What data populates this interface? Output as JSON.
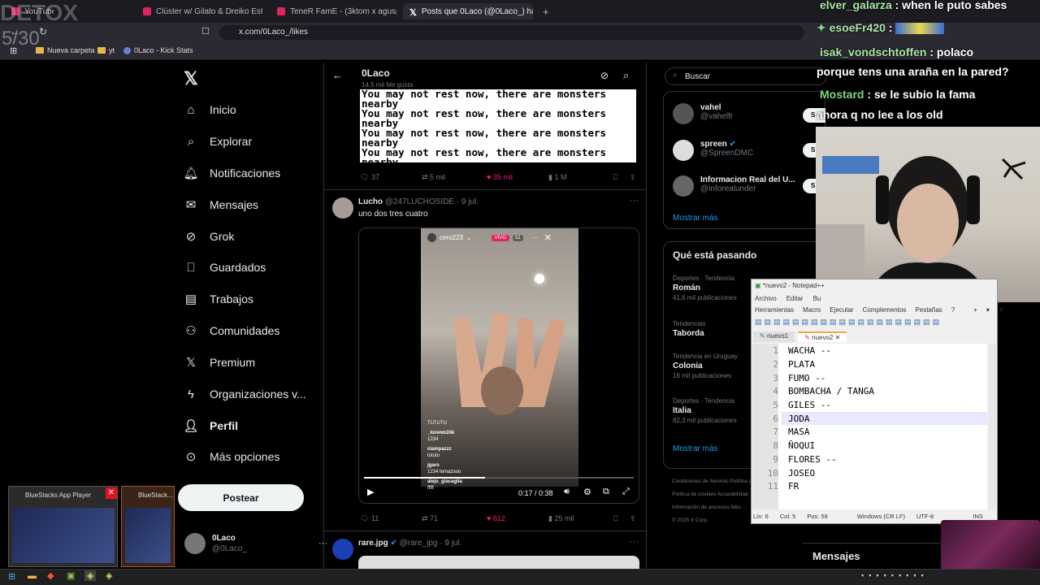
{
  "browser": {
    "tabs": [
      {
        "label": "YouTube"
      },
      {
        "label": "Clúster w/ Gilato & Dreiko Estrada -"
      },
      {
        "label": "TeneR FamE - (3ktom x aguspvz x kid"
      },
      {
        "label": "Posts que 0Laco (@0Laco_) ha m"
      }
    ],
    "url": "x.com/0Laco_/likes",
    "bookmarks": [
      "Nueva carpeta",
      "yt",
      "0Laco - Kick Stats"
    ]
  },
  "overlay": {
    "top": "DETOX",
    "counter": "5/30"
  },
  "nav": {
    "items": [
      "Inicio",
      "Explorar",
      "Notificaciones",
      "Mensajes",
      "Grok",
      "Guardados",
      "Trabajos",
      "Comunidades",
      "Premium",
      "Organizaciones v...",
      "Perfil",
      "Más opciones"
    ],
    "post_label": "Postear",
    "profile_name": "0Laco",
    "profile_handle": "@0Laco_"
  },
  "header": {
    "title": "0Laco",
    "subtitle": "14,5 mil Me gusta"
  },
  "tweet1": {
    "image_line": "You may not rest now, there are monsters nearby",
    "replies": "37",
    "reposts": "5 mil",
    "likes": "35 mil",
    "views": "1 M"
  },
  "tweet2": {
    "name": "Lucho",
    "handle": "@247LUCHOSIDE",
    "date": "· 9 jul.",
    "text": "uno dos tres cuatro",
    "live_user": "cero223",
    "live_badge": "VIVO",
    "live_viewers": "52",
    "comments": [
      {
        "user": "TUTUTU",
        "msg": ""
      },
      {
        "user": "_lorenm24k",
        "msg": "1234"
      },
      {
        "user": "ciampazzz",
        "msg": "tututu"
      },
      {
        "user": "jgaro",
        "msg": "1234 temazooo"
      },
      {
        "user": "alejo_giacaglia",
        "msg": "fffff"
      }
    ],
    "time": "0:17 / 0:38",
    "replies": "11",
    "reposts": "71",
    "likes": "612",
    "views": "25 mil"
  },
  "tweet3": {
    "name": "rare.jpg",
    "handle": "@rare_jpg",
    "date": "· 9 jul."
  },
  "search": {
    "placeholder": "Buscar"
  },
  "who": [
    {
      "name": "vahel",
      "handle": "@vahelfr",
      "btn": "S"
    },
    {
      "name": "spreen",
      "handle": "@SpreenDMC",
      "btn": "S"
    },
    {
      "name": "Informacion Real del U...",
      "handle": "@inforealunder",
      "btn": "S"
    }
  ],
  "show_more": "Mostrar más",
  "trends_title": "Qué está pasando",
  "trends": [
    {
      "cat": "Deportes · Tendencia",
      "name": "Román",
      "count": "41,6 mil publicaciones"
    },
    {
      "cat": "Tendencias",
      "name": "Taborda",
      "count": ""
    },
    {
      "cat": "Tendencia en Uruguay",
      "name": "Colonia",
      "count": "16 mil publicaciones"
    },
    {
      "cat": "Deportes · Tendencia",
      "name": "Italia",
      "count": "82,3 mil publicaciones"
    }
  ],
  "footer": {
    "links": "Condiciones de Servicio   Política de Privacidad",
    "links2": "Política de cookies   Accesibilidad",
    "links3": "Información de anuncios   Más ···",
    "copy": "© 2025 X Corp."
  },
  "chat": [
    {
      "user": "elver_galarza",
      "msg": ": when le puto sabes",
      "color": "#a8e6a1"
    },
    {
      "user": "esoeFr420",
      "msg": ":",
      "color": "#a8e6a1"
    },
    {
      "user": "isak_vondschtoffen",
      "msg": ": polaco",
      "color": "#a8e6a1"
    },
    {
      "user": "",
      "msg": "porque tens una araña en la pared?",
      "color": "#ffffff"
    },
    {
      "user": "Mostard",
      "msg": ": se le subio la fama",
      "color": "#7fd67f"
    },
    {
      "user": "",
      "msg": "ahora q no lee a los old",
      "color": "#ffffff"
    }
  ],
  "notepad": {
    "title": "*nuevo2 - Notepad++",
    "menu1": [
      "Archivo",
      "Editar",
      "Bu"
    ],
    "menu2": [
      "Herramientas",
      "Macro",
      "Ejecutar",
      "Complementos",
      "Pestañas",
      "?"
    ],
    "tabs": [
      "nuevo1",
      "nuevo2"
    ],
    "lines": [
      "WACHA --",
      "PLATA",
      "FUMO --",
      "BOMBACHA / TANGA",
      "GILES --",
      "JODA",
      "MASA",
      "ÑOQUI",
      "FLORES --",
      "JOSEO",
      "FR"
    ],
    "status": [
      "Lín: 6",
      "Col: 5",
      "Pos: 59",
      "Windows (CR LF)",
      "UTF-8",
      "INS"
    ]
  },
  "taskbar": {
    "thumb1": "BlueStacks App Player",
    "thumb2": "BlueStack..."
  },
  "messages_label": "Mensajes"
}
